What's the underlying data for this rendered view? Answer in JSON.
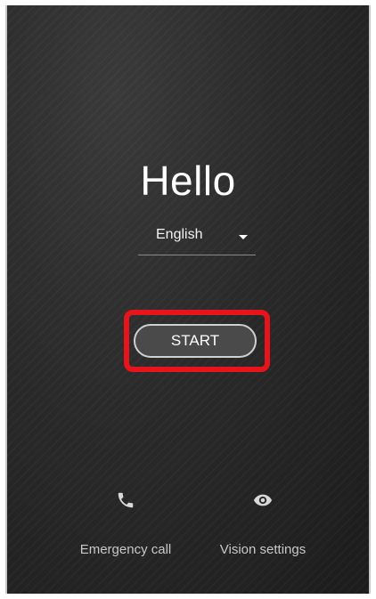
{
  "welcome": {
    "title": "Hello",
    "language": {
      "selected": "English",
      "icon": "dropdown-caret-icon"
    },
    "start_button": {
      "label": "START",
      "highlighted": true,
      "highlight_color": "#e8141b"
    }
  },
  "bottom_actions": [
    {
      "label": "Emergency call",
      "icon": "phone-icon"
    },
    {
      "label": "Vision settings",
      "icon": "eye-icon"
    }
  ],
  "colors": {
    "background": "#262626",
    "text": "#ffffff",
    "secondary_text": "#c8c8c8"
  }
}
